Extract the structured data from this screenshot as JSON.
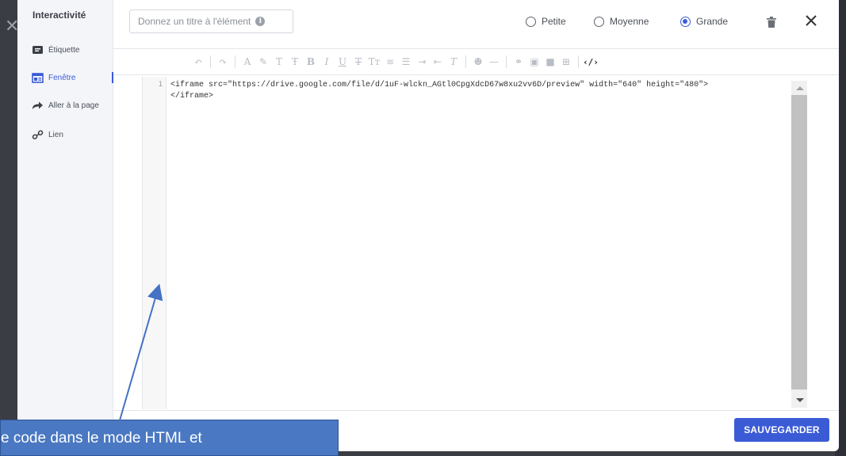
{
  "sidebar": {
    "title": "Interactivité",
    "items": [
      {
        "label": "Étiquette",
        "icon": "label-icon"
      },
      {
        "label": "Fenêtre",
        "icon": "window-icon"
      },
      {
        "label": "Aller à la page",
        "icon": "goto-page-icon"
      },
      {
        "label": "Lien",
        "icon": "link-icon"
      }
    ]
  },
  "header": {
    "title_placeholder": "Donnez un titre à l'élément",
    "sizes": [
      {
        "label": "Petite",
        "selected": false
      },
      {
        "label": "Moyenne",
        "selected": false
      },
      {
        "label": "Grande",
        "selected": true
      }
    ]
  },
  "editor": {
    "line_number": "1",
    "code": "<iframe src=\"https://drive.google.com/file/d/1uF-wlckn_AGtl0CpgXdcD67w8xu2vv6D/preview\" width=\"640\" height=\"480\">\n</iframe>"
  },
  "footer": {
    "save_label": "SAUVEGARDER"
  },
  "annotation": {
    "text": "e code dans le mode HTML et"
  },
  "colors": {
    "accent": "#3b5bd6",
    "callout": "#4a78c2"
  }
}
